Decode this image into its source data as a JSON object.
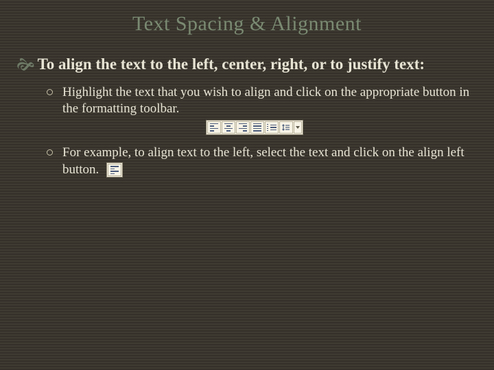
{
  "title": "Text Spacing & Alignment",
  "main_bullet": "To align the text to the left, center, right, or to justify text:",
  "sub": {
    "a": "Highlight the text that you wish to align and click on the appropriate button in the formatting toolbar.",
    "b": "For example, to align text to the left, select the text and click on the align left button."
  },
  "icons": {
    "align_left": "align-left-icon",
    "align_center": "align-center-icon",
    "align_right": "align-right-icon",
    "justify": "justify-icon",
    "numbered_list": "numbered-list-icon",
    "line_spacing": "line-spacing-icon",
    "dropdown": "dropdown-icon"
  }
}
